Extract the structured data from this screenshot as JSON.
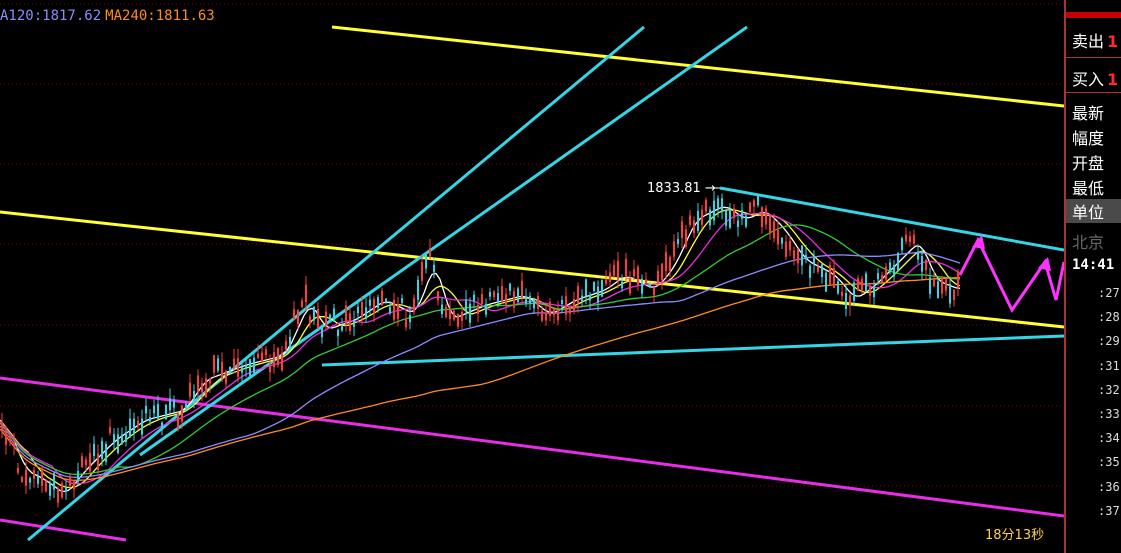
{
  "legend": {
    "ma120": "A120:1817.62",
    "ma240": "MA240:1811.63"
  },
  "peak_label": "1833.81",
  "timer": "18分13秒",
  "side": {
    "sell_label": "卖出",
    "sell_value": "1",
    "buy_label": "买入",
    "buy_value": "1",
    "fields": [
      "最新",
      "幅度",
      "开盘",
      "最低",
      "单位",
      "北京"
    ],
    "time": "14:41",
    "ticks": [
      ":27",
      ":28",
      ":29",
      ":31",
      ":32",
      ":33",
      ":34",
      ":35",
      ":36",
      ":37"
    ]
  },
  "colors": {
    "background": "#000000",
    "cyan_trend": "#33d6e6",
    "yellow_trend": "#ffff33",
    "magenta_trend": "#e52ee5",
    "grid": "#8b0000",
    "ma120": "#8b8bff",
    "ma240": "#ff8c1a",
    "up_candle": "#ff3b3b",
    "down_candle": "#33d6e6"
  },
  "chart_data": {
    "type": "line",
    "peak": 1833.81,
    "series": [
      {
        "name": "MA120",
        "last": 1817.62
      },
      {
        "name": "MA240",
        "last": 1811.63
      }
    ]
  }
}
